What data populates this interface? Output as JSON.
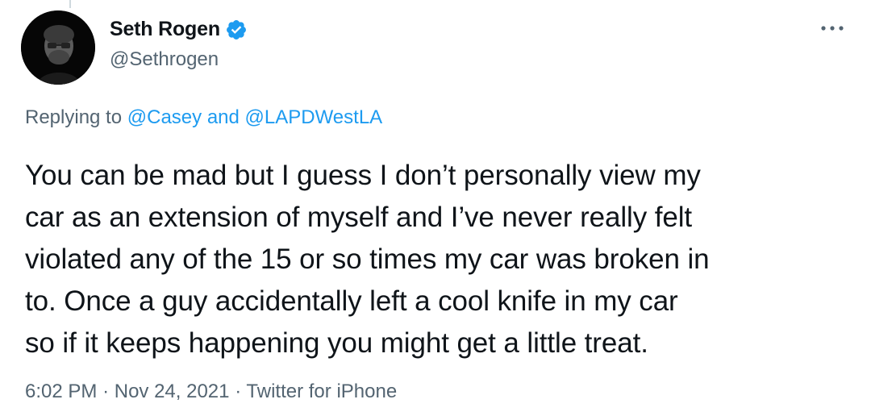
{
  "author": {
    "display_name": "Seth Rogen",
    "handle": "@Sethrogen",
    "verified": true,
    "verified_color": "#1d9bf0"
  },
  "more_icon": "more-horizontal-icon",
  "reply": {
    "prefix": "Replying to",
    "mention_1": "@Casey",
    "conjunction": "and",
    "mention_2": "@LAPDWestLA",
    "mention_color": "#1d9bf0"
  },
  "tweet": {
    "lines": [
      "You can be mad but I guess I don’t personally view my",
      "car as an extension of myself and I’ve never really felt",
      "violated any of the 15 or so times my car was broken in",
      "to. Once a guy accidentally left a cool knife in my car",
      "so if it keeps happening you might get a little treat."
    ]
  },
  "meta": {
    "time": "6:02 PM",
    "separator": "·",
    "date": "Nov 24, 2021",
    "source": "Twitter for iPhone"
  }
}
